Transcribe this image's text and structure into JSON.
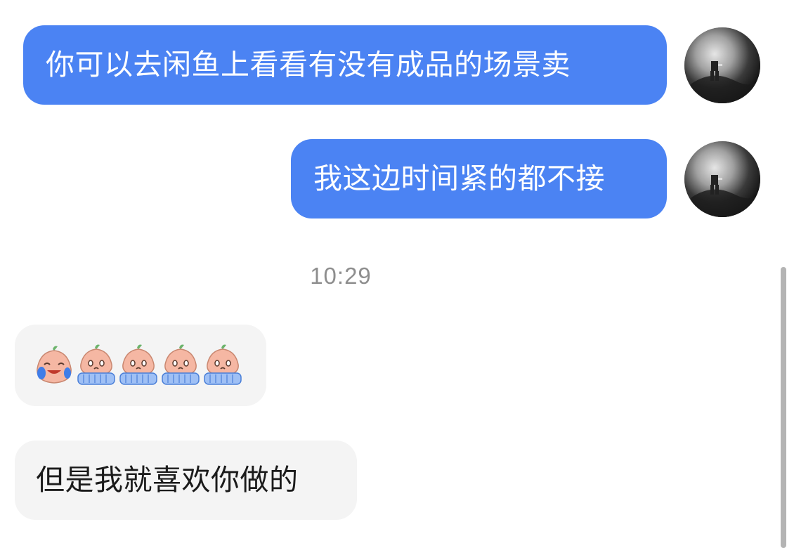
{
  "messages": [
    {
      "id": "m1",
      "direction": "outgoing",
      "text": "你可以去闲鱼上看看有没有成品的场景卖"
    },
    {
      "id": "m2",
      "direction": "outgoing",
      "text": "我这边时间紧的都不接"
    },
    {
      "id": "m3",
      "direction": "incoming",
      "emoji_sticker": [
        "crying-peach-icon",
        "crying-peach-icon",
        "crying-peach-icon",
        "crying-peach-icon",
        "crying-peach-icon"
      ]
    },
    {
      "id": "m4",
      "direction": "incoming",
      "text": "但是我就喜欢你做的"
    }
  ],
  "timestamp": "10:29",
  "colors": {
    "outgoing_bubble": "#4b83f3",
    "incoming_bubble": "#f4f4f4",
    "timestamp_text": "#8e8e8e"
  }
}
